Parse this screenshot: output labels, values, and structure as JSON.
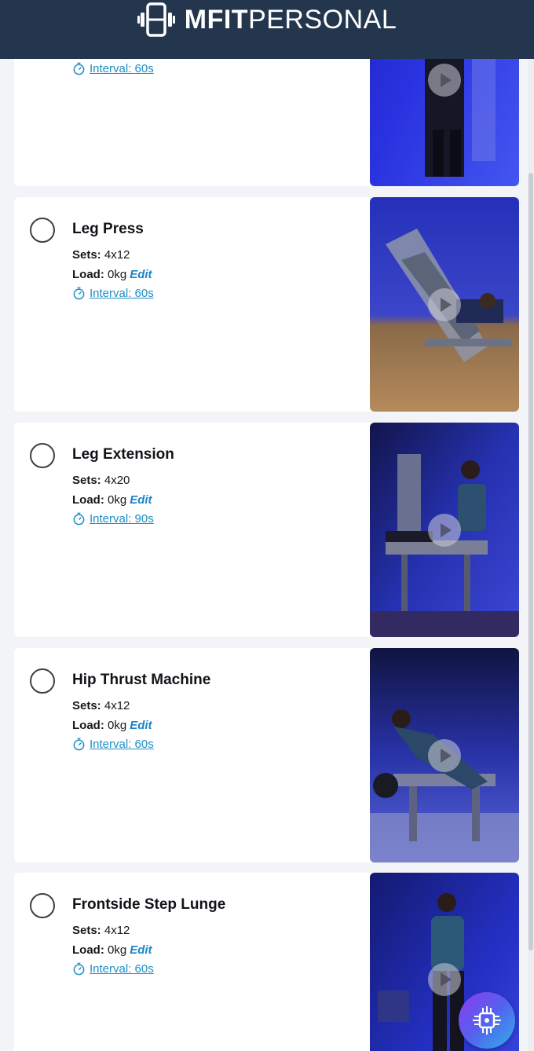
{
  "brand": {
    "name_bold": "MFIT",
    "name_light": "PERSONAL"
  },
  "labels": {
    "sets": "Sets:",
    "load": "Load:",
    "edit": "Edit"
  },
  "icons": {
    "logo": "dumbbell-logo-icon",
    "check": "circle-checkbox-icon",
    "timer": "timer-icon",
    "play": "play-icon",
    "fab": "ai-chip-icon"
  },
  "colors": {
    "header_bg": "#24364d",
    "link": "#1d8fc4",
    "edit": "#1d83c8"
  },
  "exercises": [
    {
      "name": "",
      "sets": "",
      "load": "",
      "interval": "Interval: 60s"
    },
    {
      "name": "Leg Press",
      "sets": "4x12",
      "load": "0kg",
      "interval": "Interval: 60s"
    },
    {
      "name": "Leg Extension",
      "sets": "4x20",
      "load": "0kg",
      "interval": "Interval: 90s"
    },
    {
      "name": "Hip Thrust Machine",
      "sets": "4x12",
      "load": "0kg",
      "interval": "Interval: 60s"
    },
    {
      "name": "Frontside Step Lunge",
      "sets": "4x12",
      "load": "0kg",
      "interval": "Interval: 60s"
    }
  ]
}
